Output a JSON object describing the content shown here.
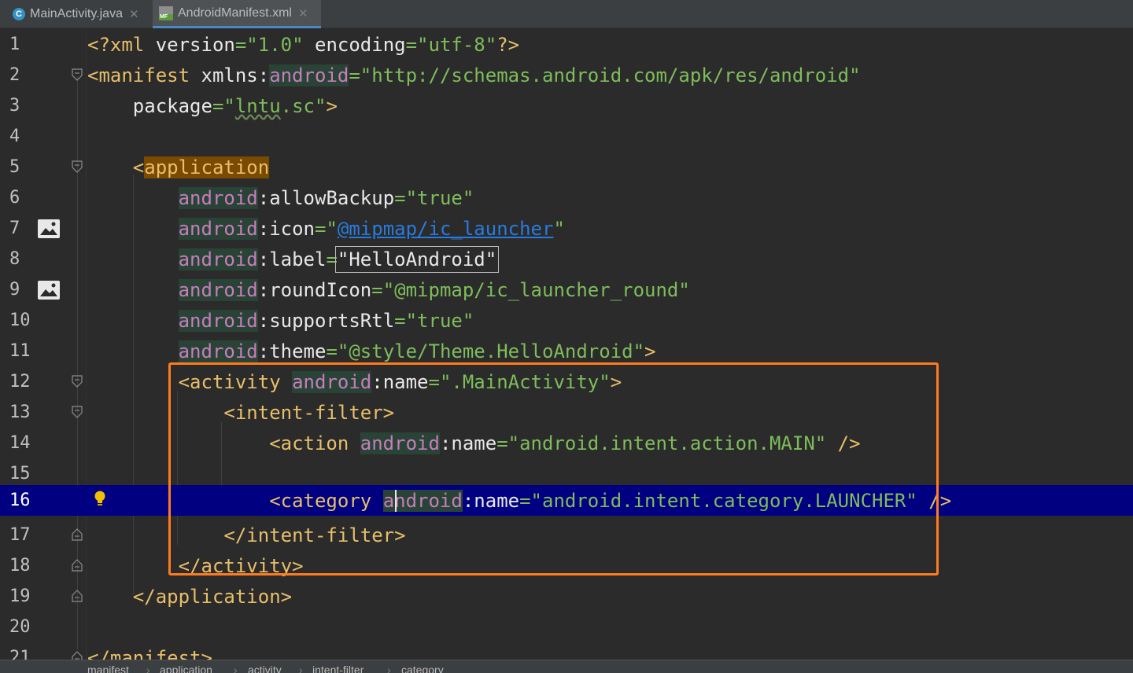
{
  "tabs": [
    {
      "label": "MainActivity.java",
      "icon": "java-class-icon",
      "active": false
    },
    {
      "label": "AndroidManifest.xml",
      "icon": "manifest-file-icon",
      "active": true
    }
  ],
  "tab_close_glyph": "✕",
  "line_numbers": [
    "1",
    "2",
    "3",
    "4",
    "5",
    "6",
    "7",
    "8",
    "9",
    "10",
    "11",
    "12",
    "13",
    "14",
    "15",
    "16",
    "17",
    "18",
    "19",
    "20",
    "21"
  ],
  "current_line": 16,
  "breadcrumb": [
    "manifest",
    "application",
    "activity",
    "intent-filter",
    "category"
  ],
  "breadcrumb_separator": "›",
  "colors": {
    "background": "#2b2b2b",
    "current_line": "#000080",
    "highlight_box": "#ff7c1e",
    "tag": "#e8bf6a",
    "namespace": "#c77dbb",
    "string": "#7ebd5b"
  }
}
